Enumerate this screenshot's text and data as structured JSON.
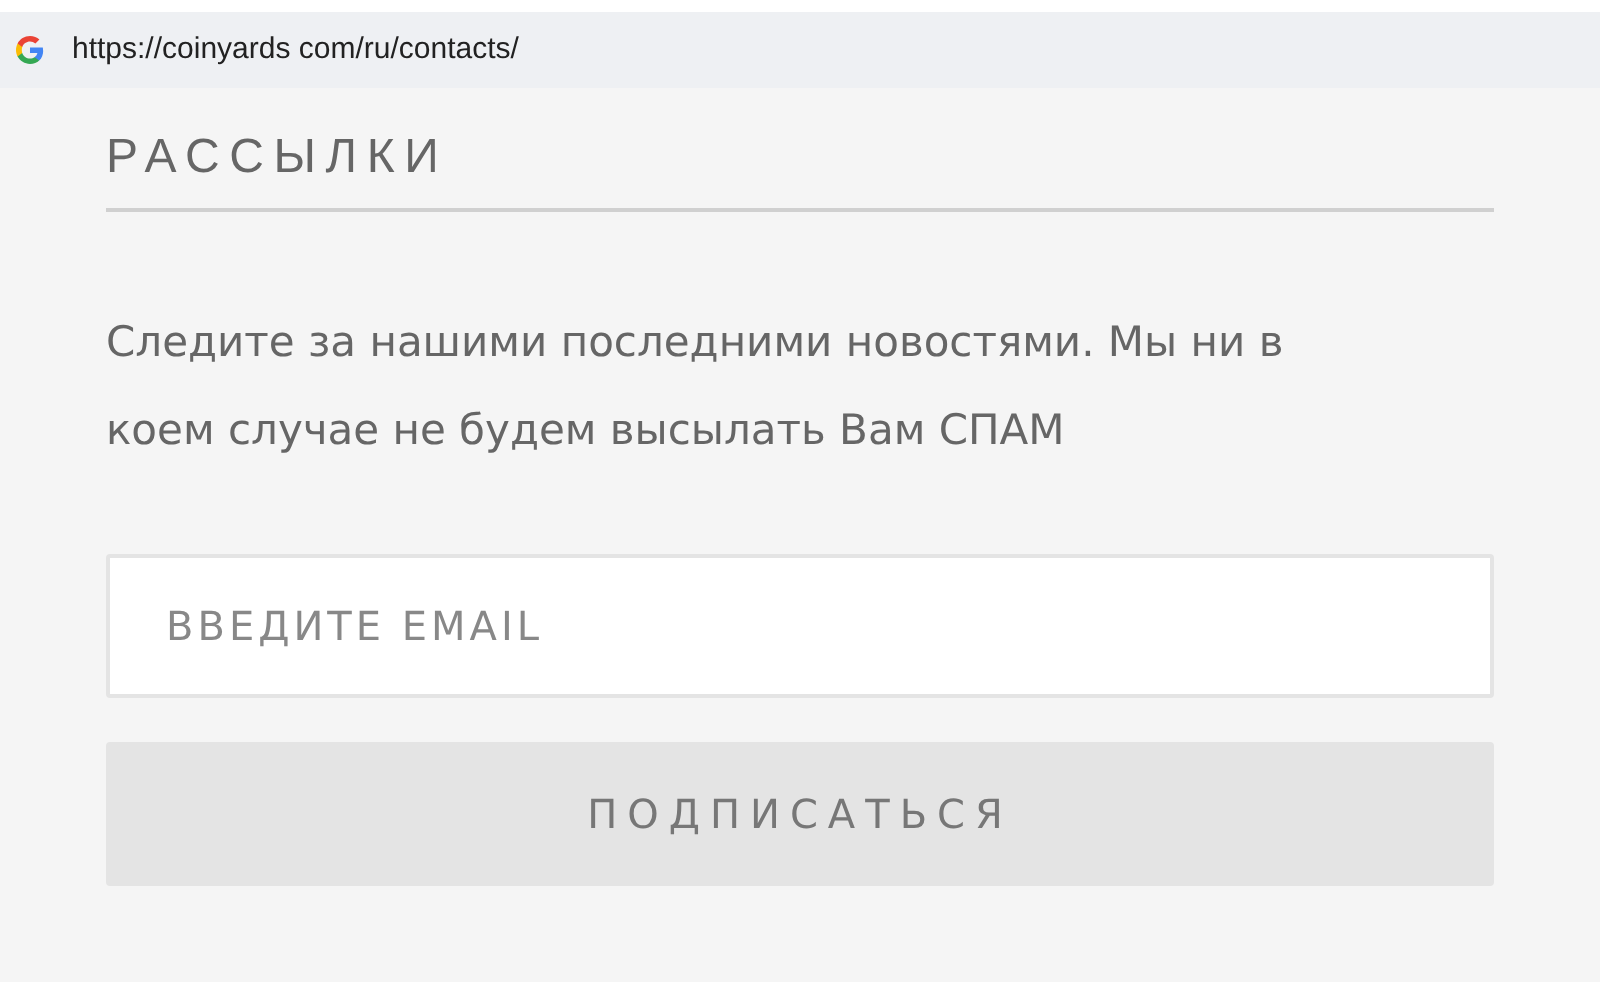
{
  "address_bar": {
    "url": "https://coinyards com/ru/contacts/"
  },
  "newsletter": {
    "title": "РАССЫЛКИ",
    "description": "Следите за нашими последними новостями. Мы ни в коем случае не будем высылать Вам СПАМ",
    "email_field": {
      "placeholder": "ВВЕДИТЕ EMAIL"
    },
    "subscribe_button": "ПОДПИСАТЬСЯ"
  }
}
